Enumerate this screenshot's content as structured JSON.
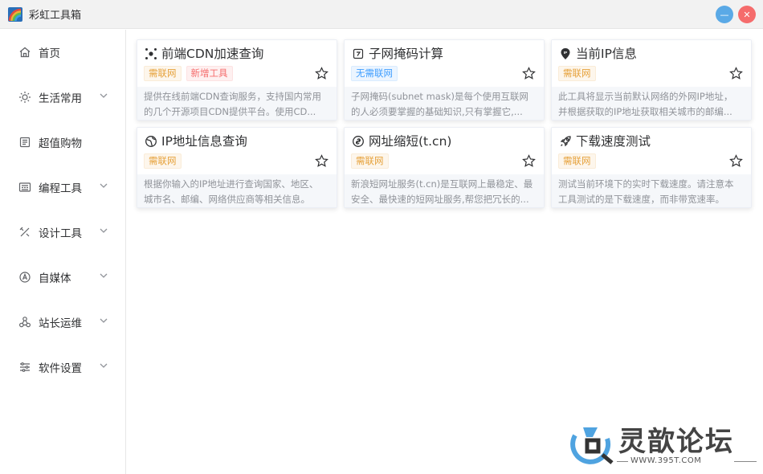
{
  "app": {
    "title": "彩虹工具箱",
    "minimize_glyph": "—",
    "close_glyph": "✕"
  },
  "sidebar": {
    "items": [
      {
        "label": "首页",
        "icon": "home-icon",
        "has_chevron": false
      },
      {
        "label": "生活常用",
        "icon": "sun-icon",
        "has_chevron": true
      },
      {
        "label": "超值购物",
        "icon": "shopping-icon",
        "has_chevron": false
      },
      {
        "label": "编程工具",
        "icon": "code-icon",
        "has_chevron": true
      },
      {
        "label": "设计工具",
        "icon": "design-icon",
        "has_chevron": true
      },
      {
        "label": "自媒体",
        "icon": "media-icon",
        "has_chevron": true
      },
      {
        "label": "站长运维",
        "icon": "ops-icon",
        "has_chevron": true
      },
      {
        "label": "软件设置",
        "icon": "settings-icon",
        "has_chevron": true
      }
    ]
  },
  "cards": [
    {
      "title": "前端CDN加速查询",
      "icon": "cdn-icon",
      "tags": [
        {
          "text": "需联网",
          "style": "orange"
        },
        {
          "text": "新增工具",
          "style": "red"
        }
      ],
      "desc_lines": [
        "提供在线前端CDN查询服务，支持国内常用",
        "的几个开源项目CDN提供平台。使用CD..."
      ]
    },
    {
      "title": "子网掩码计算",
      "icon": "calculator-icon",
      "tags": [
        {
          "text": "无需联网",
          "style": "blue"
        }
      ],
      "desc_lines": [
        "子网掩码(subnet mask)是每个使用互联网",
        "的人必须要掌握的基础知识,只有掌握它,..."
      ]
    },
    {
      "title": "当前IP信息",
      "icon": "ip-location-icon",
      "tags": [
        {
          "text": "需联网",
          "style": "orange"
        }
      ],
      "desc_lines": [
        "此工具将显示当前默认网络的外网IP地址，",
        "并根据获取的IP地址获取相关城市的邮编..."
      ]
    },
    {
      "title": "IP地址信息查询",
      "icon": "globe-icon",
      "tags": [
        {
          "text": "需联网",
          "style": "orange"
        }
      ],
      "desc_lines": [
        "根据你输入的IP地址进行查询国家、地区、",
        "城市名、邮编、网络供应商等相关信息。"
      ]
    },
    {
      "title": "网址缩短(t.cn)",
      "icon": "link-icon",
      "tags": [
        {
          "text": "需联网",
          "style": "orange"
        }
      ],
      "desc_lines": [
        "新浪短网址服务(t.cn)是互联网上最稳定、最",
        "安全、最快速的短网址服务,帮您把冗长的..."
      ]
    },
    {
      "title": "下载速度测试",
      "icon": "rocket-icon",
      "tags": [
        {
          "text": "需联网",
          "style": "orange"
        }
      ],
      "desc_lines": [
        "测试当前环境下的实时下载速度。请注意本",
        "工具测试的是下载速度，而非带宽速率。"
      ]
    }
  ],
  "watermark": {
    "text": "灵歆论坛",
    "url": "WWW.395T.COM"
  }
}
